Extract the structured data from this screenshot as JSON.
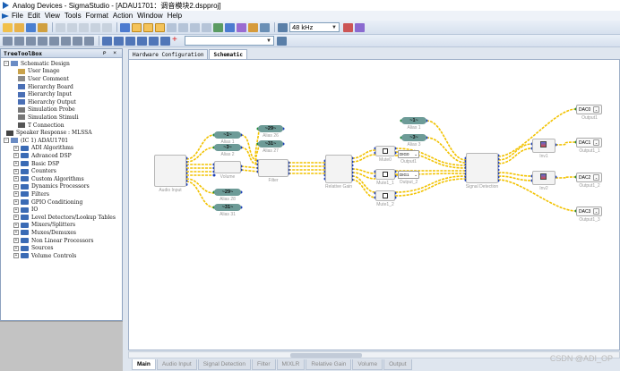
{
  "window": {
    "title": "Analog Devices - SigmaStudio - [ADAU1701：调音模块2.dspproj]"
  },
  "menu": [
    "File",
    "Edit",
    "View",
    "Tools",
    "Format",
    "Action",
    "Window",
    "Help"
  ],
  "toolbar": {
    "sample_rate": "48 kHz"
  },
  "toolbox": {
    "title": "TreeToolBox",
    "controls": "ᴘ ×",
    "items": [
      {
        "label": "Schematic Design",
        "expander": "−",
        "icon": "schematic-icon"
      },
      {
        "label": "User Image",
        "icon": "image-icon"
      },
      {
        "label": "User Comment",
        "icon": "comment-icon"
      },
      {
        "label": "Hierarchy Board",
        "icon": "board-icon"
      },
      {
        "label": "Hierarchy Input",
        "icon": "input-icon"
      },
      {
        "label": "Hierarchy Output",
        "icon": "output-icon"
      },
      {
        "label": "Simulation Probe",
        "icon": "probe-icon"
      },
      {
        "label": "Simulation Stimuli",
        "icon": "stimuli-icon"
      },
      {
        "label": "T Connection",
        "icon": "t-connection-icon"
      },
      {
        "label": "Speaker Response : MLSSA",
        "icon": "speaker-icon"
      },
      {
        "label": "(IC 1) ADAU1701",
        "expander": "−",
        "icon": "chip-icon"
      },
      {
        "label": "ADI Algorithms",
        "expander": "+",
        "icon": "folder-icon"
      },
      {
        "label": "Advanced DSP",
        "expander": "+",
        "icon": "folder-icon"
      },
      {
        "label": "Basic DSP",
        "expander": "+",
        "icon": "folder-icon"
      },
      {
        "label": "Counters",
        "expander": "+",
        "icon": "folder-icon"
      },
      {
        "label": "Custom Algorithms",
        "expander": "+",
        "icon": "folder-icon"
      },
      {
        "label": "Dynamics Processors",
        "expander": "+",
        "icon": "folder-icon"
      },
      {
        "label": "Filters",
        "expander": "+",
        "icon": "folder-icon"
      },
      {
        "label": "GPIO Conditioning",
        "expander": "+",
        "icon": "folder-icon"
      },
      {
        "label": "IO",
        "expander": "+",
        "icon": "folder-icon"
      },
      {
        "label": "Level Detectors/Lookup Tables",
        "expander": "+",
        "icon": "folder-icon"
      },
      {
        "label": "Mixers/Splitters",
        "expander": "+",
        "icon": "folder-icon"
      },
      {
        "label": "Muxes/Demuxes",
        "expander": "+",
        "icon": "folder-icon"
      },
      {
        "label": "Non Linear Processors",
        "expander": "+",
        "icon": "folder-icon"
      },
      {
        "label": "Sources",
        "expander": "+",
        "icon": "folder-icon"
      },
      {
        "label": "Volume Controls",
        "expander": "+",
        "icon": "folder-icon"
      }
    ]
  },
  "doc_tabs": [
    "Hardware Configuration",
    "Schematic"
  ],
  "schematic": {
    "blocks": {
      "audio_input": "Audio Input",
      "volume": "Volume",
      "filter": "Filter",
      "relative_gain": "Relative Gain",
      "signal_detection": "Signal Detection",
      "mute0": "Mute0",
      "mute1": "Mute1_1",
      "mute2": "Mute1_2",
      "output1": "Output1",
      "output2": "Output_2",
      "inv1": "Inv1",
      "inv2": "Inv2",
      "dac_out1": "Output1",
      "dac_out2": "Output1_1",
      "dac_out3": "Output1_2",
      "dac_out4": "Output1_3"
    },
    "aliases": [
      {
        "text": "~1~",
        "label": "Alias 1"
      },
      {
        "text": "~3~",
        "label": "Alias 2"
      },
      {
        "text": "~29~",
        "label": "Alias 26"
      },
      {
        "text": "~31~",
        "label": "Alias 27"
      },
      {
        "text": "~29~",
        "label": "Alias 28"
      },
      {
        "text": "~31~",
        "label": "Alias 31"
      },
      {
        "text": "~1~",
        "label": "Alias 1"
      },
      {
        "text": "~3~",
        "label": "Alias 3"
      }
    ],
    "selectors": [
      "DIG0",
      "DIG1"
    ],
    "dacs": [
      "DAC0",
      "DAC1",
      "DAC2",
      "DAC3"
    ]
  },
  "bottom_tabs": [
    "Main",
    "Audio Input",
    "Signal Detection",
    "Filter",
    "MIXLR",
    "Relative Gain",
    "Volume",
    "Output"
  ],
  "watermark": "CSDN @ADI_OP",
  "colors": {
    "wire": "#f2c200",
    "pin": "#1c3fb8",
    "alias": "#6d9b97"
  }
}
